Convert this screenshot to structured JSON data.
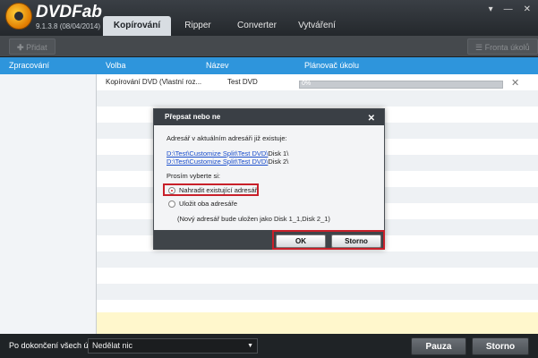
{
  "app": {
    "brand": "DVDFab",
    "version": "9.1.3.8 (08/04/2014)"
  },
  "tabs": [
    {
      "label": "Kopírování",
      "active": true
    },
    {
      "label": "Ripper",
      "active": false
    },
    {
      "label": "Converter",
      "active": false
    },
    {
      "label": "Vytváření",
      "active": false
    }
  ],
  "toolbar": {
    "add_label": "Přidat",
    "queue_label": "Fronta úkolů"
  },
  "columns": {
    "processing": "Zpracování",
    "option": "Volba",
    "name": "Název",
    "scheduler": "Plánovač úkolu"
  },
  "tasks": [
    {
      "option": "Kopírování DVD (Vlastní roz...",
      "name": "Test DVD",
      "progress_text": "0%",
      "progress": 0
    }
  ],
  "dialog": {
    "title": "Přepsat nebo ne",
    "message": "Adresář v aktuálním adresáři již existuje:",
    "path1_link": "D:\\Test\\Customize Split\\Test DVD\\",
    "path1_tail": "Disk 1\\",
    "path2_link": "D:\\Test\\Customize Split\\Test DVD\\",
    "path2_tail": "Disk 2\\",
    "prompt": "Prosím vyberte si:",
    "option_replace": "Nahradit existující adresář",
    "option_keep": "Uložit oba adresáře",
    "note": "(Nový adresář bude uložen jako Disk 1_1,Disk 2_1)",
    "ok": "OK",
    "cancel": "Storno"
  },
  "footer": {
    "label": "Po dokončení všech úkolů:",
    "select_value": "Nedělat nic",
    "pause": "Pauza",
    "cancel": "Storno"
  },
  "colors": {
    "accent": "#2e95dc",
    "highlight": "#c8202a"
  }
}
